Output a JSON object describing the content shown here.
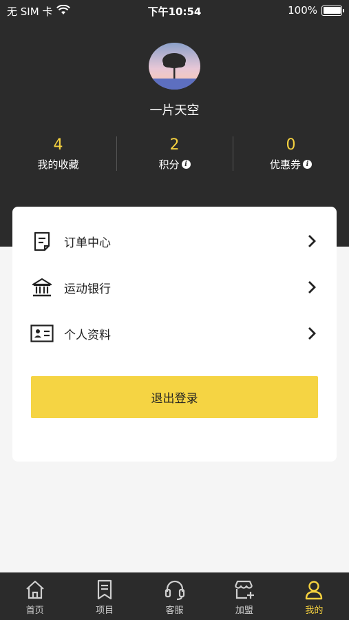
{
  "status_bar": {
    "carrier": "无 SIM 卡",
    "time": "下午10:54",
    "battery": "100%"
  },
  "profile": {
    "username": "一片天空"
  },
  "stats": [
    {
      "value": "4",
      "label": "我的收藏",
      "has_info": false
    },
    {
      "value": "2",
      "label": "积分",
      "has_info": true
    },
    {
      "value": "0",
      "label": "优惠券",
      "has_info": true
    }
  ],
  "menu": [
    {
      "label": "订单中心",
      "icon": "order-icon"
    },
    {
      "label": "运动银行",
      "icon": "bank-icon"
    },
    {
      "label": "个人资料",
      "icon": "profile-card-icon"
    }
  ],
  "logout_label": "退出登录",
  "tabs": [
    {
      "label": "首页",
      "icon": "home-icon",
      "active": false
    },
    {
      "label": "项目",
      "icon": "bookmark-icon",
      "active": false
    },
    {
      "label": "客服",
      "icon": "headset-icon",
      "active": false
    },
    {
      "label": "加盟",
      "icon": "store-add-icon",
      "active": false
    },
    {
      "label": "我的",
      "icon": "user-icon",
      "active": true
    }
  ],
  "colors": {
    "header_bg": "#2b2b2b",
    "accent": "#f5d13f",
    "button": "#f5d443"
  }
}
